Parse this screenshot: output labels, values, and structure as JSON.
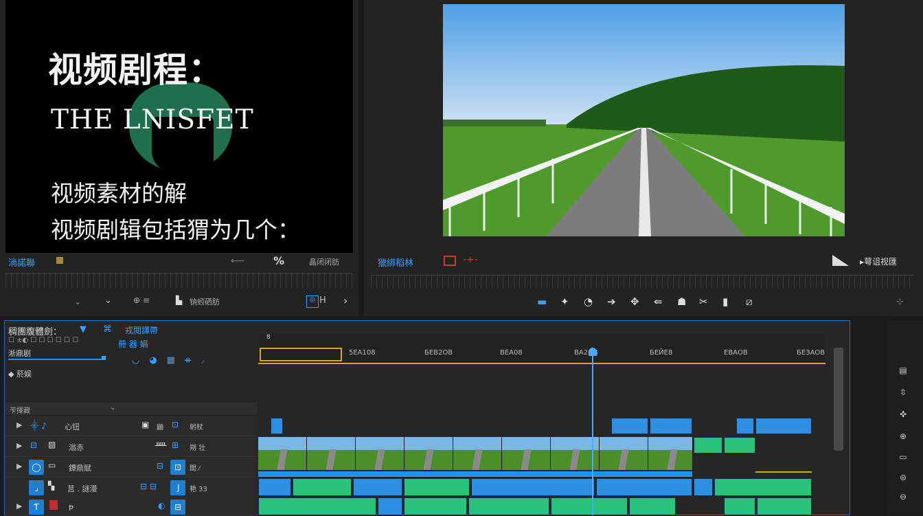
{
  "source_monitor": {
    "title_line": "视频剧程：",
    "title_en": "THE LNISFET",
    "subtitle1": "视频素材的解",
    "subtitle2": "视频剧辑包括猬为几个：",
    "panel_label": "淌諾聯",
    "percent": "%",
    "right_text": "晶闭闭肪",
    "bottom_label": "钠蚓硒肪",
    "fit_label": "H"
  },
  "program_monitor": {
    "panel_label": "獵綁稻林",
    "right_label": "▸萼诅视匯",
    "transport_icons": [
      "marker-icon",
      "mark-in-icon",
      "go-to-in-icon",
      "step-back-icon",
      "play-icon",
      "step-forward-icon",
      "go-to-out-icon",
      "lift-icon",
      "extract-icon",
      "export-frame-icon"
    ]
  },
  "timeline": {
    "panel_title": "稠團腹體劍：",
    "panel_tab": "戎閱譯帶",
    "tab_sub": "冊 器 娟",
    "row_info": "☐ ±◐ ☐ ☐ ☐ ☐ ☐ ☐",
    "search_value": "淅鼎剧",
    "add_label": "◆ 菸娱",
    "section_label": "苄揮藏",
    "timecodes": [
      "5ЕА108",
      "БЕВ2ОВ",
      "ΒΕΑ08",
      "ВА2ОВ",
      "БЕЙЕ8",
      "ЕВАОВ",
      "БЕЗАОВ"
    ],
    "marker_label": "8",
    "tracks": [
      {
        "name": "心钮",
        "label2": "鼬",
        "label3": "躬杖"
      },
      {
        "name": "滃赤",
        "label2": "",
        "label3": "朔 壮"
      },
      {
        "name": "鐔鼎賦",
        "label2": "",
        "label3": "閻 ⁄"
      },
      {
        "name": "莒 . 謎漫",
        "label2": "",
        "label3": "艳 33"
      },
      {
        "name": "ᵽ",
        "label2": "",
        "label3": ""
      }
    ]
  },
  "colors": {
    "accent": "#2e8fe0",
    "audio_green": "#28c27a",
    "panel_border": "#2a6cb8",
    "playhead": "#4aa8ff"
  }
}
